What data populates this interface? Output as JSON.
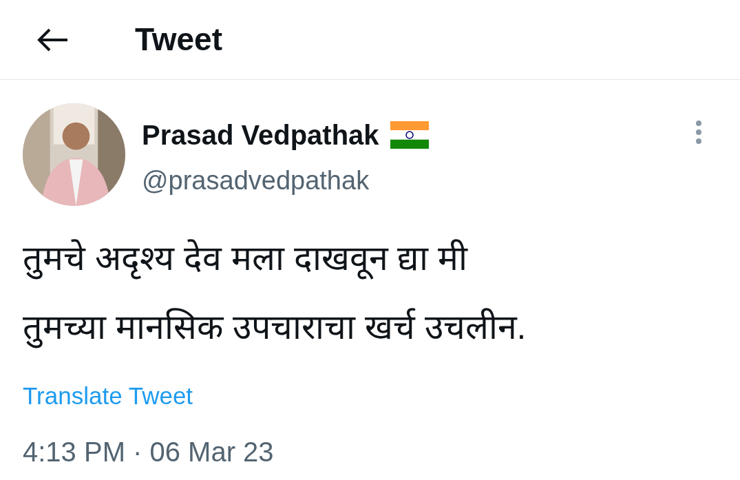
{
  "header": {
    "title": "Tweet"
  },
  "tweet": {
    "author": {
      "name": "Prasad Vedpathak",
      "handle": "@prasadvedpathak"
    },
    "text_lines": [
      "तुमचे अदृश्य देव मला दाखवून द्या मी",
      "तुमच्या मानसिक उपचाराचा खर्च उचलीन."
    ],
    "translate_link": "Translate Tweet",
    "timestamp": "4:13 PM · 06 Mar 23"
  }
}
